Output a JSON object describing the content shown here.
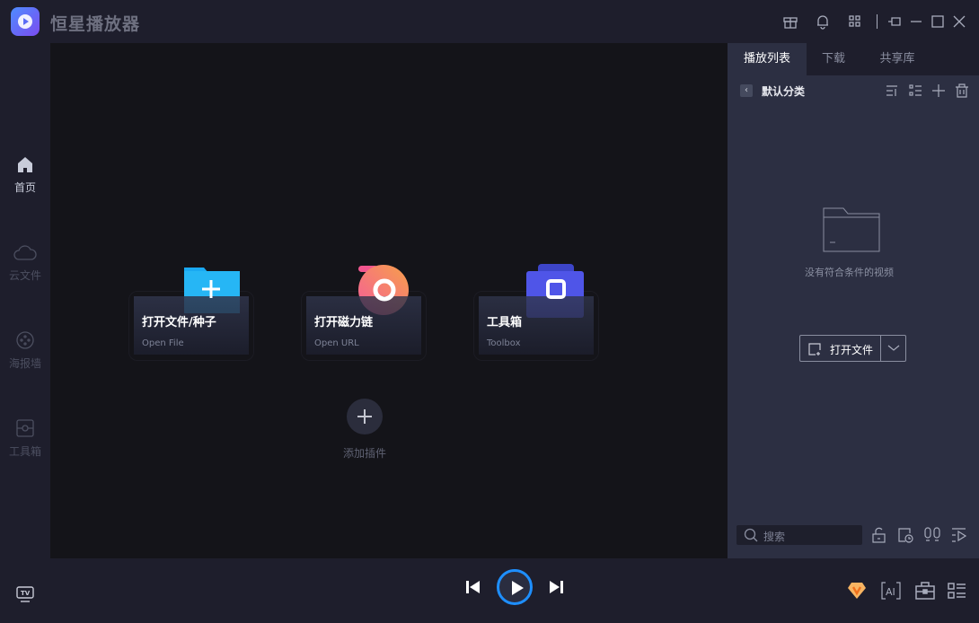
{
  "app": {
    "title": "恒星播放器"
  },
  "sidebar": {
    "items": [
      {
        "label": "首页",
        "icon": "home-icon"
      },
      {
        "label": "云文件",
        "icon": "cloud-icon"
      },
      {
        "label": "海报墙",
        "icon": "film-reel-icon"
      },
      {
        "label": "工具箱",
        "icon": "toolbox-icon"
      }
    ]
  },
  "main": {
    "cards": [
      {
        "title": "打开文件/种子",
        "subtitle": "Open File"
      },
      {
        "title": "打开磁力链",
        "subtitle": "Open URL"
      },
      {
        "title": "工具箱",
        "subtitle": "Toolbox"
      }
    ],
    "add_plugin": "添加插件"
  },
  "panel": {
    "tabs": [
      "播放列表",
      "下载",
      "共享库"
    ],
    "category": "默认分类",
    "empty_text": "没有符合条件的视频",
    "open_file": "打开文件",
    "search_placeholder": "搜索"
  },
  "colors": {
    "accent": "#1e90ff",
    "main_bg": "#141419",
    "panel_bg": "#2c2f42"
  }
}
